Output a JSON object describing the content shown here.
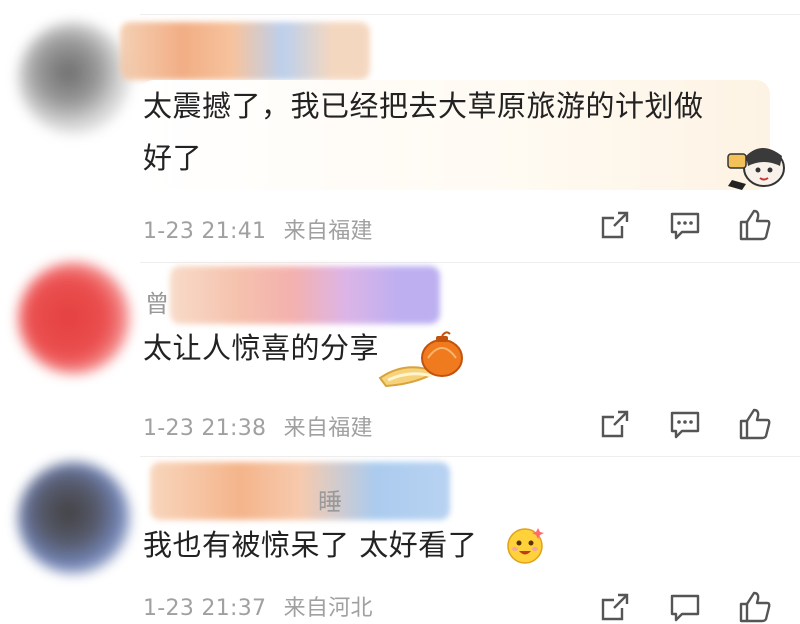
{
  "comments": [
    {
      "name": "",
      "text_line1": "太震撼了，我已经把去大草原旅游的计划做",
      "text_line2": "好了",
      "time": "1-23 21:41",
      "location": "来自福建"
    },
    {
      "name": "曾",
      "text_line1": "太让人惊喜的分享",
      "time": "1-23 21:38",
      "location": "来自福建"
    },
    {
      "name": "睡",
      "text_line1": "我也有被惊呆了 太好看了",
      "time": "1-23 21:37",
      "location": "来自河北"
    }
  ],
  "icons": {
    "share": "share-icon",
    "comment": "comment-icon",
    "like": "thumbs-up-icon"
  },
  "colors": {
    "text": "#222222",
    "meta": "#a0a0a0",
    "icon": "#555555"
  }
}
